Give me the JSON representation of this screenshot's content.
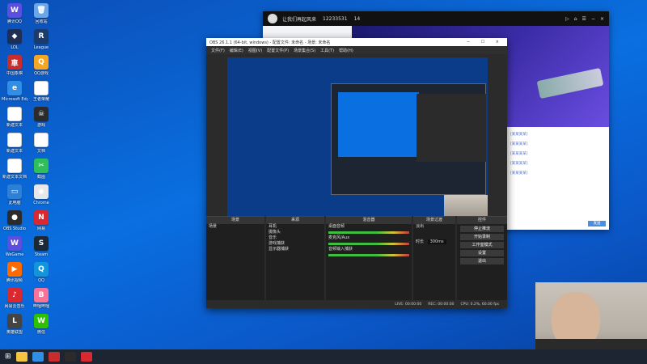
{
  "desktop_icons": [
    {
      "label": "腾讯QQ",
      "color": "#5b4fe0",
      "glyph": "W"
    },
    {
      "label": "LOL",
      "color": "#1f2e55",
      "glyph": "◆"
    },
    {
      "label": "中国象棋",
      "color": "#c82d2d",
      "glyph": "車"
    },
    {
      "label": "Microsoft Edge",
      "color": "#2f8fe6",
      "glyph": "e"
    },
    {
      "label": "新建文本",
      "color": "#ffffff",
      "glyph": ""
    },
    {
      "label": "新建文本",
      "color": "#ffffff",
      "glyph": ""
    },
    {
      "label": "新建文本文档",
      "color": "#ffffff",
      "glyph": ""
    },
    {
      "label": "此电脑",
      "color": "#2e7fd6",
      "glyph": "▭"
    },
    {
      "label": "OBS Studio",
      "color": "#2b2b2b",
      "glyph": "●"
    },
    {
      "label": "WeGame",
      "color": "#5b4fe0",
      "glyph": "W"
    },
    {
      "label": "腾讯视频",
      "color": "#ff6a00",
      "glyph": "▶"
    },
    {
      "label": "网易云音乐",
      "color": "#d9282f",
      "glyph": "♪"
    },
    {
      "label": "英雄联盟",
      "color": "#444",
      "glyph": "L"
    },
    {
      "label": "回收站",
      "color": "#6aa6e8",
      "glyph": "🗑"
    },
    {
      "label": "League",
      "color": "#1c3b6b",
      "glyph": "R"
    },
    {
      "label": "QQ游戏",
      "color": "#f5a623",
      "glyph": "Q"
    },
    {
      "label": "王者荣耀",
      "color": "#ffffff",
      "glyph": ""
    },
    {
      "label": "游戏",
      "color": "#2b2b2b",
      "glyph": "☠"
    },
    {
      "label": "文档",
      "color": "#ffffff",
      "glyph": ""
    },
    {
      "label": "截图",
      "color": "#2fbf5a",
      "glyph": "✂"
    },
    {
      "label": "Chrome",
      "color": "#e8e8e8",
      "glyph": "◉"
    },
    {
      "label": "网易",
      "color": "#d9282f",
      "glyph": "N"
    },
    {
      "label": "Steam",
      "color": "#1b2838",
      "glyph": "S"
    },
    {
      "label": "QQ",
      "color": "#1296db",
      "glyph": "Q"
    },
    {
      "label": "哔哩哔哩",
      "color": "#fb7299",
      "glyph": "B"
    },
    {
      "label": "微信",
      "color": "#2dc100",
      "glyph": "W"
    }
  ],
  "taskbar": {
    "start_label": "开始"
  },
  "browser": {
    "channel_title": "让我们再起风来",
    "room_id": "12233531",
    "viewers": "14",
    "banner_text": "福领",
    "chat_lines": [
      "[某某某某]",
      "[某某某某]",
      "[某某某某]",
      "[某某某某]",
      "[某某某某]"
    ],
    "send_label": "发送"
  },
  "obs": {
    "window_title": "OBS 26.1.1 (64-bit, windows) - 配置文件: 未命名 - 场景: 未命名",
    "menu": [
      "文件(F)",
      "编辑(E)",
      "视图(V)",
      "配置文件(P)",
      "场景集合(S)",
      "工具(T)",
      "帮助(H)"
    ],
    "docks": {
      "scenes": {
        "title": "场景",
        "items": [
          "场景"
        ]
      },
      "sources": {
        "title": "来源",
        "items": [
          "耳机",
          "摄像头",
          "音乐",
          "游戏捕获",
          "显示器捕获"
        ]
      },
      "mixer": {
        "title": "混音器",
        "items": [
          "桌面音频",
          "麦克风/Aux",
          "音频输入捕获"
        ]
      },
      "transitions": {
        "title": "场景过渡",
        "fade": "淡出",
        "duration_label": "时长",
        "duration": "300ms"
      },
      "controls": {
        "title": "控件",
        "buttons": [
          "停止推流",
          "开始录制",
          "工作室模式",
          "设置",
          "退出"
        ]
      }
    },
    "status": {
      "live": "LIVE: 00:00:00",
      "rec": "REC: 00:00:00",
      "cpu": "CPU: 0.2%, 60.00 fps"
    }
  }
}
